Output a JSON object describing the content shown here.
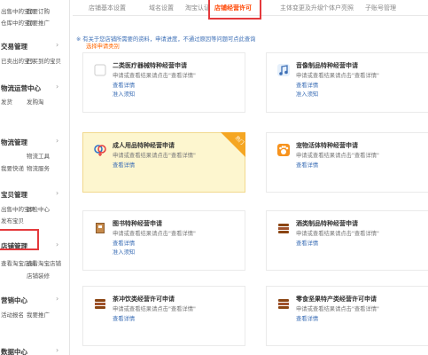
{
  "sidebar": {
    "groups": [
      {
        "title": "",
        "links": [
          "出售中的宝贝",
          "我要订购",
          "仓库中的宝贝",
          "我要推广"
        ]
      },
      {
        "title": "交易管理",
        "links": [
          "已卖出的宝贝",
          "已买到的宝贝"
        ]
      },
      {
        "title": "物流运营中心",
        "links": [
          "发货",
          "发购淘"
        ]
      },
      {
        "title": "物流管理",
        "links": [
          "物流工具",
          "我要快递",
          "物流服务"
        ]
      },
      {
        "title": "宝贝管理",
        "links": [
          "出售中的宝贝",
          "体检中心",
          "发布宝贝"
        ]
      },
      {
        "title": "店铺管理",
        "links": [
          "查看淘宝店铺",
          "查看淘宝店铺",
          "店铺装修"
        ]
      },
      {
        "title": "营销中心",
        "links": [
          "我要推广",
          "活动报名"
        ]
      },
      {
        "title": "数据中心",
        "links": []
      }
    ]
  },
  "tabs": [
    "店铺基本设置",
    "域名设置",
    "淘宝认证",
    "店铺经营许可",
    "主体变更及升级",
    "个体户亮照",
    "子账号管理"
  ],
  "active_tab": "店铺经营许可",
  "notice": "※ 有关于您店铺所需要的资料，申请进度，不通过原因等问题可点此查询",
  "section_title": "选择申请类别",
  "cards": [
    {
      "title": "二类医疗器械特种经营申请",
      "desc": "申请或查看结果请点击\"查看详情\"",
      "links": [
        "查看详情",
        "准入须知"
      ],
      "icon": "medical-icon"
    },
    {
      "title": "音像制品特种经营申请",
      "desc": "申请或查看结果请点击\"查看详情\"",
      "links": [
        "查看详情",
        "准入须知"
      ],
      "icon": "music-note-icon"
    },
    {
      "title": "成人用品特种经营申请",
      "desc": "申请或查看结果请点击\"查看详情\"",
      "links": [
        "查看详情"
      ],
      "icon": "gender-icon",
      "badge": "热门"
    },
    {
      "title": "宠物活体特种经营申请",
      "desc": "申请或查看结果请点击\"查看详情\"",
      "links": [
        "查看详情"
      ],
      "icon": "paw-icon"
    },
    {
      "title": "图书特种经营申请",
      "desc": "申请或查看结果请点击\"查看详情\"",
      "links": [
        "查看详情",
        "准入须知"
      ],
      "icon": "book-icon"
    },
    {
      "title": "酒类制品特种经营申请",
      "desc": "申请或查看结果请点击\"查看详情\"",
      "links": [
        "查看详情"
      ],
      "icon": "wine-icon"
    },
    {
      "title": "茶冲饮类经营许可申请",
      "desc": "申请或查看结果请点击\"查看详情\"",
      "links": [
        "查看详情"
      ],
      "icon": "tea-icon"
    },
    {
      "title": "零食坚果特产类经营许可申请",
      "desc": "申请或查看结果请点击\"查看详情\"",
      "links": [
        "查看详情"
      ],
      "icon": "snack-icon"
    }
  ]
}
